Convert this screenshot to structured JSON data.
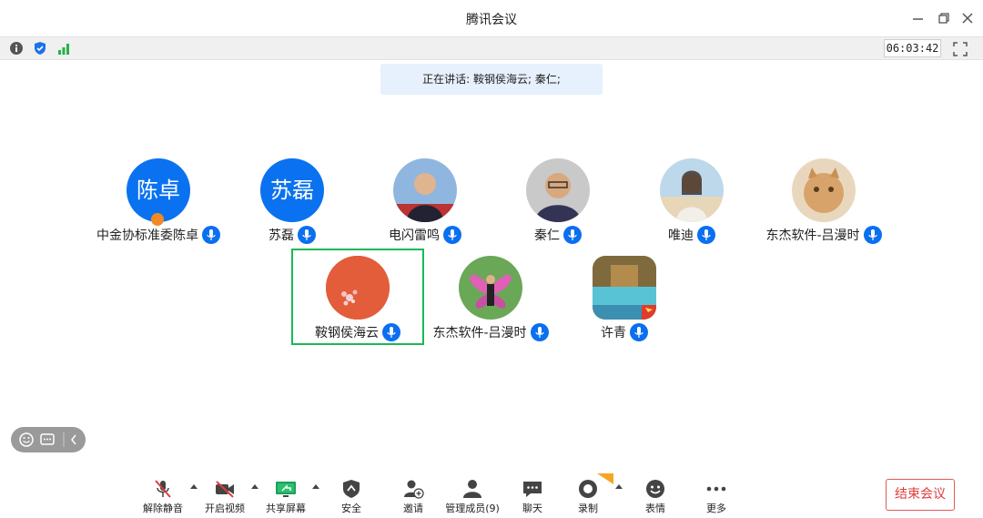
{
  "window": {
    "title": "腾讯会议"
  },
  "status": {
    "timer": "06:03:42"
  },
  "speaking": {
    "text": "正在讲话: 鞍钢侯海云; 秦仁;"
  },
  "participants": [
    {
      "name": "中金协标准委陈卓",
      "avatar_text": "陈卓",
      "avatar_type": "text"
    },
    {
      "name": "苏磊",
      "avatar_text": "苏磊",
      "avatar_type": "text"
    },
    {
      "name": "电闪雷鸣",
      "avatar_type": "photo"
    },
    {
      "name": "秦仁",
      "avatar_type": "photo"
    },
    {
      "name": "唯迪",
      "avatar_type": "photo"
    },
    {
      "name": "东杰软件-吕漫时",
      "avatar_type": "photo"
    },
    {
      "name": "鞍钢侯海云",
      "avatar_type": "photo",
      "active_speaker": true
    },
    {
      "name": "东杰软件-吕漫时",
      "avatar_type": "photo"
    },
    {
      "name": "许青",
      "avatar_type": "photo"
    }
  ],
  "toolbar": {
    "mute": "解除静音",
    "video": "开启视频",
    "share": "共享屏幕",
    "security": "安全",
    "invite": "邀请",
    "members": "管理成员(9)",
    "chat": "聊天",
    "record": "录制",
    "reactions": "表情",
    "more": "更多",
    "end": "结束会议"
  },
  "colors": {
    "accent": "#0a6ff0",
    "active_border": "#19b955",
    "end": "#e03c3c"
  }
}
